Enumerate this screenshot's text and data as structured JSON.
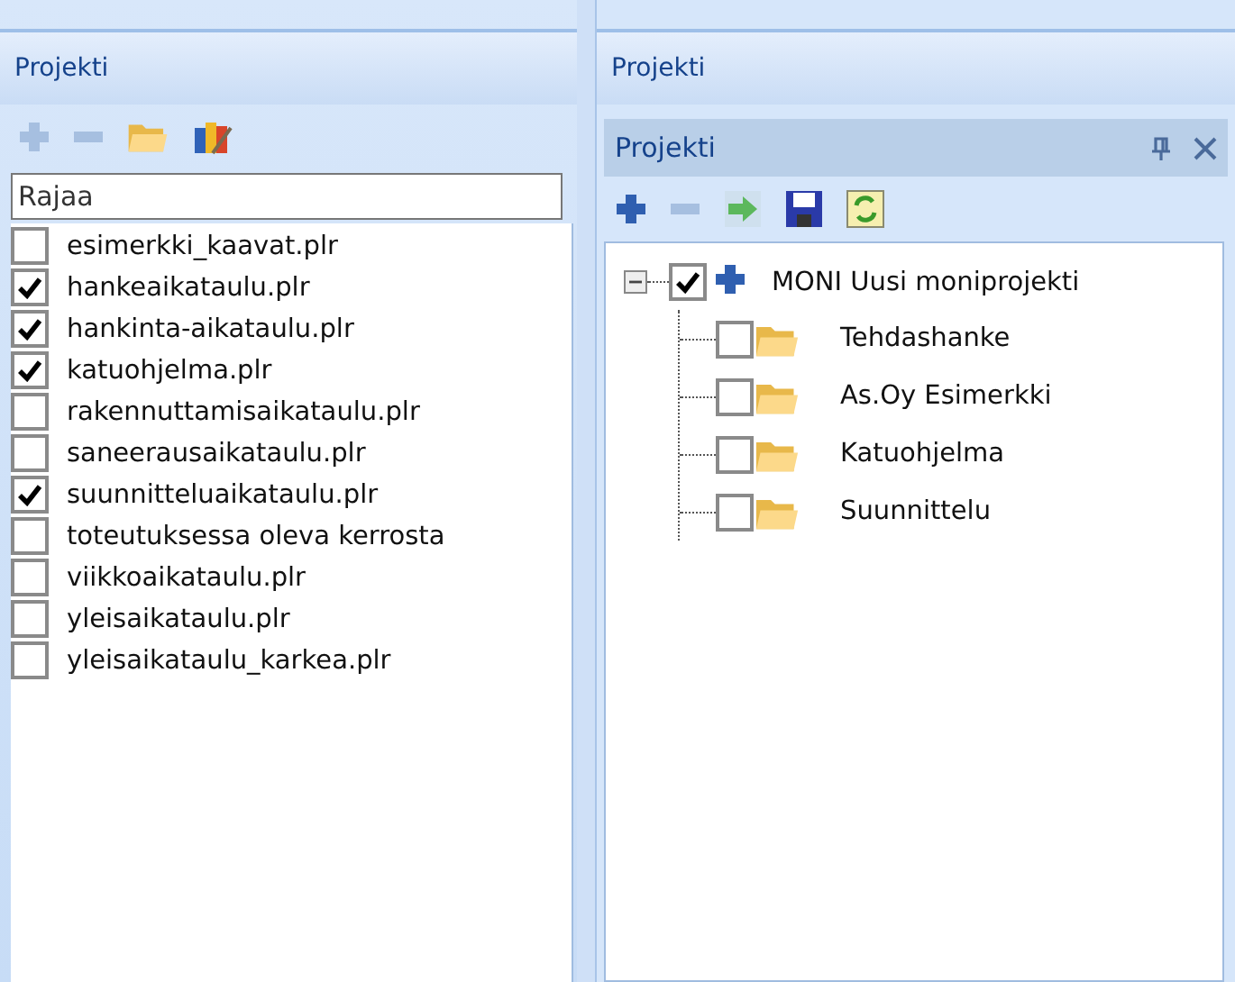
{
  "left_panel": {
    "title": "Projekti",
    "filter": {
      "placeholder": "Rajaa"
    },
    "files": [
      {
        "name": "esimerkki_kaavat.plr",
        "checked": false
      },
      {
        "name": "hankeaikataulu.plr",
        "checked": true
      },
      {
        "name": "hankinta-aikataulu.plr",
        "checked": true
      },
      {
        "name": "katuohjelma.plr",
        "checked": true
      },
      {
        "name": "rakennuttamisaikataulu.plr",
        "checked": false
      },
      {
        "name": "saneerausaikataulu.plr",
        "checked": false
      },
      {
        "name": "suunnitteluaikataulu.plr",
        "checked": true
      },
      {
        "name": "toteutuksessa oleva kerrosta",
        "checked": false
      },
      {
        "name": "viikkoaikataulu.plr",
        "checked": false
      },
      {
        "name": "yleisaikataulu.plr",
        "checked": false
      },
      {
        "name": "yleisaikataulu_karkea.plr",
        "checked": false
      }
    ]
  },
  "right_panel": {
    "title": "Projekti",
    "inner_title": "Projekti",
    "tree": [
      {
        "label": "MONI Uusi moniprojekti",
        "checked": true,
        "expanded": true,
        "children": [
          {
            "label": "Tehdashanke",
            "checked": false
          },
          {
            "label": "As.Oy Esimerkki",
            "checked": false
          },
          {
            "label": "Katuohjelma",
            "checked": false
          },
          {
            "label": "Suunnittelu",
            "checked": false
          }
        ]
      }
    ]
  }
}
